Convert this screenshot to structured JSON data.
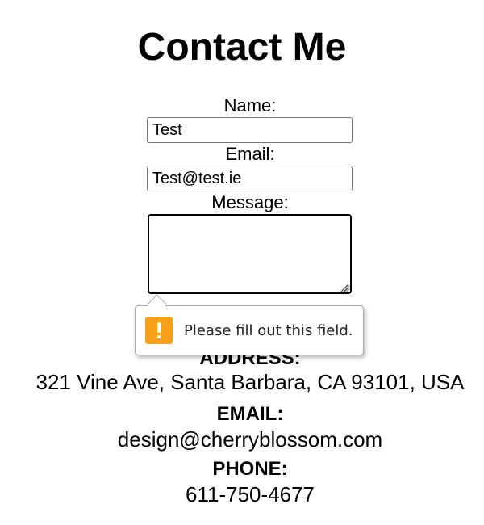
{
  "page": {
    "title": "Contact Me"
  },
  "form": {
    "name_label": "Name:",
    "name_value": "Test",
    "email_label": "Email:",
    "email_value": "Test@test.ie",
    "message_label": "Message:",
    "message_value": ""
  },
  "validation": {
    "message": "Please fill out this field.",
    "icon": "warning-icon",
    "icon_color": "#f7a11a"
  },
  "contact_info": {
    "address_heading": "ADDRESS:",
    "address_value": "321 Vine Ave, Santa Barbara, CA 93101, USA",
    "email_heading": "EMAIL:",
    "email_value": "design@cherryblossom.com",
    "phone_heading": "PHONE:",
    "phone_value": "611-750-4677"
  }
}
